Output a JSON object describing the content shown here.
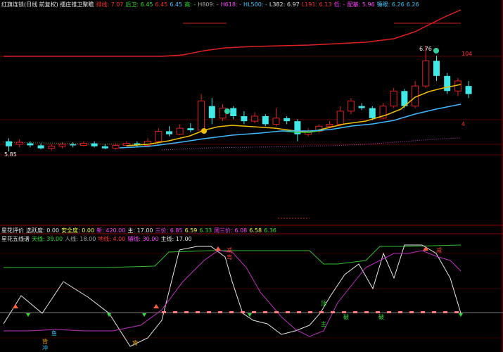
{
  "main_header": [
    {
      "text": "红旗连锁(日线 前复权) 擂庄锥卫聚瞻",
      "color": "#e8e8e8"
    },
    {
      "text": "排线: 7.07",
      "color": "#ff3030"
    },
    {
      "text": "后卫: 6.45",
      "color": "#30e030"
    },
    {
      "text": "6.45",
      "color": "#ff3030"
    },
    {
      "text": "6.45",
      "color": "#40c8ff"
    },
    {
      "text": "高: -",
      "color": "#30e030"
    },
    {
      "text": "H809: -",
      "color": "#aaaaaa"
    },
    {
      "text": "H618: -",
      "color": "#ff40ff"
    },
    {
      "text": "HL500: -",
      "color": "#40c8ff"
    },
    {
      "text": "L382: 6.97",
      "color": "#e8e8e8"
    },
    {
      "text": "L191: 6.13",
      "color": "#ff3030"
    },
    {
      "text": "低: -",
      "color": "#ff40ff"
    },
    {
      "text": "配基: 5.96",
      "color": "#ff40ff"
    },
    {
      "text": "锤眼: 6.26",
      "color": "#40c8ff"
    },
    {
      "text": "6.26",
      "color": "#40c8ff"
    }
  ],
  "price_labels": {
    "high": "6.76",
    "low": "5.85",
    "right_top": "104",
    "right_mid": "4"
  },
  "panel2_header": [
    {
      "text": "星花评价",
      "color": "#e8e8e8"
    },
    {
      "text": "选跃度: 0.00",
      "color": "#e8e8e8"
    },
    {
      "text": "安全度: 0.00",
      "color": "#ffff40"
    },
    {
      "text": "新: 420.00",
      "color": "#ff40ff"
    },
    {
      "text": "主: 17.00",
      "color": "#e8e8e8"
    },
    {
      "text": "三价: 6.85",
      "color": "#ff40ff"
    },
    {
      "text": "6.59",
      "color": "#ffff40"
    },
    {
      "text": "6.33",
      "color": "#30e030"
    },
    {
      "text": "周三价: 6.08",
      "color": "#ff40ff"
    },
    {
      "text": "6.58",
      "color": "#ffff40"
    },
    {
      "text": "6.36",
      "color": "#30e030"
    }
  ],
  "panel3_header": [
    {
      "text": "星花五线谱",
      "color": "#e8e8e8"
    },
    {
      "text": "天线: 39.00",
      "color": "#30e030"
    },
    {
      "text": "人线: 18.00",
      "color": "#aaaaaa"
    },
    {
      "text": "地线: 4.00",
      "color": "#ff3030"
    },
    {
      "text": "辅线: 30.00",
      "color": "#ff40ff"
    },
    {
      "text": "主线: 17.00",
      "color": "#e8e8e8"
    }
  ],
  "osc_labels": [
    {
      "text": "减",
      "color": "#ff4040"
    },
    {
      "text": "弯",
      "color": "#ff4040"
    },
    {
      "text": "减",
      "color": "#ff4040"
    },
    {
      "text": "背",
      "color": "#ffaa00"
    },
    {
      "text": "背",
      "color": "#ffaa00"
    },
    {
      "text": "背",
      "color": "#ffaa00"
    },
    {
      "text": "鱼",
      "color": "#40c8ff"
    },
    {
      "text": "顶",
      "color": "#30e030"
    },
    {
      "text": "主",
      "color": "#30e030"
    },
    {
      "text": "破",
      "color": "#30e030"
    },
    {
      "text": "破",
      "color": "#30e030"
    },
    {
      "text": "冲",
      "color": "#40c8ff"
    }
  ],
  "chart_data": {
    "type": "candlestick",
    "candles": [
      {
        "o": 5.95,
        "c": 5.9,
        "h": 5.98,
        "l": 5.85
      },
      {
        "o": 5.92,
        "c": 5.94,
        "h": 5.97,
        "l": 5.89
      },
      {
        "o": 5.93,
        "c": 5.91,
        "h": 5.95,
        "l": 5.89
      },
      {
        "o": 5.91,
        "c": 5.88,
        "h": 5.93,
        "l": 5.87
      },
      {
        "o": 5.88,
        "c": 5.9,
        "h": 5.92,
        "l": 5.86
      },
      {
        "o": 5.9,
        "c": 5.92,
        "h": 5.94,
        "l": 5.88
      },
      {
        "o": 5.92,
        "c": 5.91,
        "h": 5.94,
        "l": 5.89
      },
      {
        "o": 5.91,
        "c": 5.93,
        "h": 5.95,
        "l": 5.9
      },
      {
        "o": 5.93,
        "c": 5.9,
        "h": 5.95,
        "l": 5.89
      },
      {
        "o": 5.9,
        "c": 5.88,
        "h": 5.92,
        "l": 5.87
      },
      {
        "o": 5.88,
        "c": 5.91,
        "h": 5.93,
        "l": 5.87
      },
      {
        "o": 5.91,
        "c": 5.93,
        "h": 5.95,
        "l": 5.9
      },
      {
        "o": 5.93,
        "c": 5.91,
        "h": 5.95,
        "l": 5.89
      },
      {
        "o": 5.91,
        "c": 5.95,
        "h": 5.98,
        "l": 5.9
      },
      {
        "o": 5.95,
        "c": 6.05,
        "h": 6.08,
        "l": 5.94
      },
      {
        "o": 6.05,
        "c": 6.02,
        "h": 6.1,
        "l": 6.0
      },
      {
        "o": 6.02,
        "c": 6.08,
        "h": 6.12,
        "l": 6.01
      },
      {
        "o": 6.08,
        "c": 6.06,
        "h": 6.13,
        "l": 6.04
      },
      {
        "o": 6.06,
        "c": 6.35,
        "h": 6.42,
        "l": 6.05
      },
      {
        "o": 6.3,
        "c": 6.18,
        "h": 6.38,
        "l": 6.12
      },
      {
        "o": 6.18,
        "c": 6.28,
        "h": 6.32,
        "l": 6.15
      },
      {
        "o": 6.28,
        "c": 6.2,
        "h": 6.3,
        "l": 6.17
      },
      {
        "o": 6.2,
        "c": 6.15,
        "h": 6.25,
        "l": 6.12
      },
      {
        "o": 6.15,
        "c": 6.2,
        "h": 6.24,
        "l": 6.13
      },
      {
        "o": 6.2,
        "c": 6.12,
        "h": 6.22,
        "l": 6.1
      },
      {
        "o": 6.12,
        "c": 6.18,
        "h": 6.28,
        "l": 6.1
      },
      {
        "o": 6.18,
        "c": 6.15,
        "h": 6.2,
        "l": 6.12
      },
      {
        "o": 6.15,
        "c": 6.02,
        "h": 6.17,
        "l": 5.95
      },
      {
        "o": 6.02,
        "c": 6.05,
        "h": 6.08,
        "l": 6.0
      },
      {
        "o": 6.05,
        "c": 6.1,
        "h": 6.12,
        "l": 6.03
      },
      {
        "o": 6.1,
        "c": 6.12,
        "h": 6.15,
        "l": 6.08
      },
      {
        "o": 6.12,
        "c": 6.25,
        "h": 6.3,
        "l": 6.1
      },
      {
        "o": 6.25,
        "c": 6.35,
        "h": 6.38,
        "l": 6.22
      },
      {
        "o": 6.3,
        "c": 6.28,
        "h": 6.33,
        "l": 6.26
      },
      {
        "o": 6.28,
        "c": 6.18,
        "h": 6.3,
        "l": 6.16
      },
      {
        "o": 6.18,
        "c": 6.3,
        "h": 6.33,
        "l": 6.17
      },
      {
        "o": 6.3,
        "c": 6.45,
        "h": 6.48,
        "l": 6.28
      },
      {
        "o": 6.45,
        "c": 6.3,
        "h": 6.47,
        "l": 6.28
      },
      {
        "o": 6.3,
        "c": 6.5,
        "h": 6.55,
        "l": 6.28
      },
      {
        "o": 6.5,
        "c": 6.75,
        "h": 6.9,
        "l": 6.48
      },
      {
        "o": 6.75,
        "c": 6.6,
        "h": 6.8,
        "l": 6.55
      },
      {
        "o": 6.6,
        "c": 6.45,
        "h": 6.63,
        "l": 6.42
      },
      {
        "o": 6.45,
        "c": 6.55,
        "h": 6.58,
        "l": 6.4
      },
      {
        "o": 6.5,
        "c": 6.42,
        "h": 6.55,
        "l": 6.38
      }
    ]
  }
}
